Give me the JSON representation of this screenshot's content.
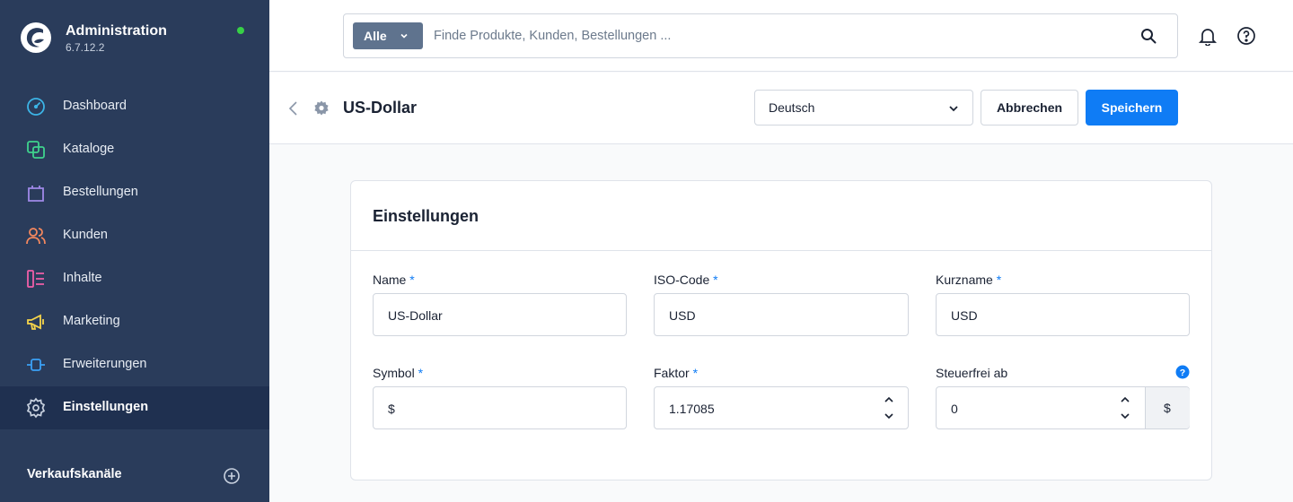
{
  "sidebar": {
    "title": "Administration",
    "version": "6.7.12.2",
    "items": [
      {
        "label": "Dashboard",
        "icon": "dashboard-icon",
        "color": "#3cb4e6"
      },
      {
        "label": "Kataloge",
        "icon": "catalog-icon",
        "color": "#3fd38d"
      },
      {
        "label": "Bestellungen",
        "icon": "shopping-bag-icon",
        "color": "#a089e8"
      },
      {
        "label": "Kunden",
        "icon": "users-icon",
        "color": "#f5885e"
      },
      {
        "label": "Inhalte",
        "icon": "content-icon",
        "color": "#f05fa8"
      },
      {
        "label": "Marketing",
        "icon": "megaphone-icon",
        "color": "#f7d54a"
      },
      {
        "label": "Erweiterungen",
        "icon": "plug-icon",
        "color": "#3ba0f5"
      },
      {
        "label": "Einstellungen",
        "icon": "gear-icon",
        "color": "#c9d2e0"
      }
    ],
    "sales_channels_title": "Verkaufskanäle"
  },
  "topbar": {
    "search_type": "Alle",
    "search_placeholder": "Finde Produkte, Kunden, Bestellungen ..."
  },
  "smartbar": {
    "title": "US-Dollar",
    "language": "Deutsch",
    "cancel_label": "Abbrechen",
    "save_label": "Speichern"
  },
  "card": {
    "title": "Einstellungen",
    "fields": {
      "name": {
        "label": "Name",
        "required": "*",
        "value": "US-Dollar"
      },
      "iso_code": {
        "label": "ISO-Code",
        "required": "*",
        "value": "USD"
      },
      "short_name": {
        "label": "Kurzname",
        "required": "*",
        "value": "USD"
      },
      "symbol": {
        "label": "Symbol",
        "required": "*",
        "value": "$"
      },
      "factor": {
        "label": "Faktor",
        "required": "*",
        "value": "1.17085"
      },
      "tax_free_from": {
        "label": "Steuerfrei ab",
        "value": "0",
        "suffix": "$"
      }
    }
  },
  "colors": {
    "sidebar_bg": "#2a3c5b",
    "sidebar_active": "#1f3050",
    "primary": "#0f7cf5",
    "online": "#37d046"
  }
}
